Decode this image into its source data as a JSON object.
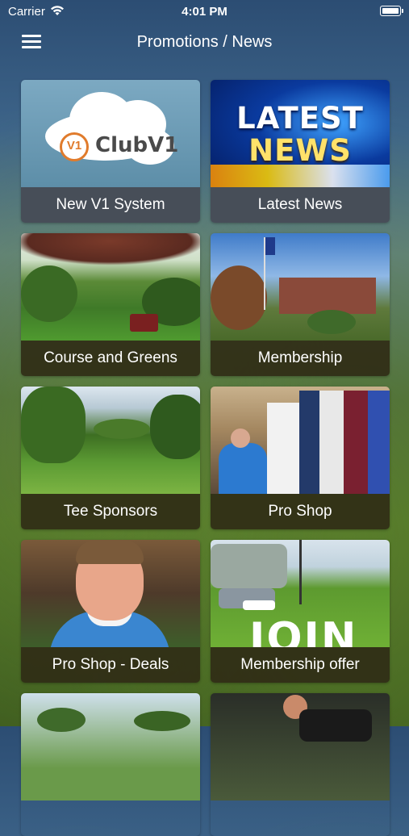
{
  "status_bar": {
    "carrier": "Carrier",
    "time": "4:01 PM"
  },
  "nav": {
    "title": "Promotions / News",
    "menu_icon": "hamburger-menu-icon"
  },
  "tiles": [
    {
      "label": "New V1 System"
    },
    {
      "label": "Latest News"
    },
    {
      "label": "Course and Greens"
    },
    {
      "label": "Membership"
    },
    {
      "label": "Tee Sponsors"
    },
    {
      "label": "Pro Shop"
    },
    {
      "label": "Pro Shop - Deals"
    },
    {
      "label": "Membership offer"
    }
  ],
  "images": {
    "clubv1_logo": "ClubV1",
    "news_line1": "LATEST",
    "news_line2": "NEWS",
    "join_text": "JOIN"
  },
  "colors": {
    "caption_grey": "#474e58",
    "caption_dark_olive": "#302c16"
  }
}
